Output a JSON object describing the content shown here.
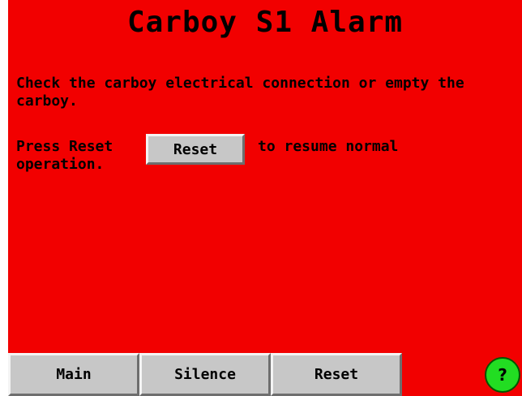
{
  "screen": {
    "title": "Carboy S1 Alarm",
    "message": "Check the carboy electrical connection or empty the carboy.",
    "instruction_before": "Press Reset",
    "inline_button_label": "Reset",
    "instruction_after": "to resume normal",
    "instruction_cont": "operation."
  },
  "nav": {
    "main_label": "Main",
    "silence_label": "Silence",
    "reset_label": "Reset",
    "help_label": "?"
  },
  "colors": {
    "alarm_background": "#f20000",
    "button_face": "#c7c7c7",
    "help_button": "#22dd22"
  }
}
